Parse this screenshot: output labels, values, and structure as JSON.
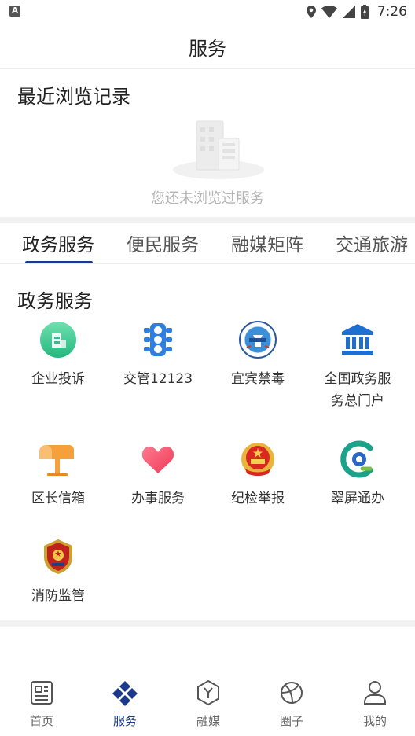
{
  "status_bar": {
    "notification_glyph": "A",
    "time": "7:26",
    "icons": [
      "location-icon",
      "wifi-icon",
      "signal-icon",
      "battery-icon"
    ]
  },
  "header": {
    "title": "服务"
  },
  "recent": {
    "title": "最近浏览记录",
    "empty_text": "您还未浏览过服务"
  },
  "tabs": [
    {
      "label": "政务服务",
      "active": true
    },
    {
      "label": "便民服务",
      "active": false
    },
    {
      "label": "融媒矩阵",
      "active": false
    },
    {
      "label": "交通旅游",
      "active": false
    }
  ],
  "section": {
    "title": "政务服务",
    "items": [
      {
        "label": "企业投诉",
        "icon": "enterprise-complaint-icon"
      },
      {
        "label": "交管12123",
        "icon": "traffic-light-icon"
      },
      {
        "label": "宜宾禁毒",
        "icon": "anti-drug-emblem-icon"
      },
      {
        "label": "全国政务服务总门户",
        "label_line1": "全国政务服",
        "label_line2": "务总门户",
        "icon": "government-building-icon"
      },
      {
        "label": "区长信箱",
        "icon": "mailbox-icon"
      },
      {
        "label": "办事服务",
        "icon": "heart-icon"
      },
      {
        "label": "纪检举报",
        "icon": "national-emblem-icon"
      },
      {
        "label": "翠屏通办",
        "icon": "cuiping-logo-icon"
      },
      {
        "label": "消防监管",
        "icon": "fire-rescue-emblem-icon"
      }
    ]
  },
  "bottom_nav": [
    {
      "label": "首页",
      "icon": "news-icon",
      "active": false
    },
    {
      "label": "服务",
      "icon": "services-diamond-icon",
      "active": true
    },
    {
      "label": "融媒",
      "icon": "media-hexagon-icon",
      "active": false
    },
    {
      "label": "圈子",
      "icon": "circle-orbit-icon",
      "active": false
    },
    {
      "label": "我的",
      "icon": "user-icon",
      "active": false
    }
  ],
  "colors": {
    "accent": "#1b3a8c",
    "divider": "#f2f2f2",
    "muted_text": "#b5b5b5"
  }
}
